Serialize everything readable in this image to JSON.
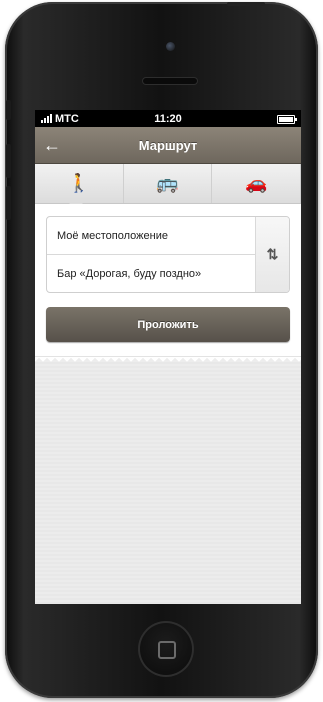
{
  "statusbar": {
    "carrier": "МТС",
    "time": "11:20"
  },
  "navbar": {
    "title": "Маршрут",
    "back_icon": "arrow-left-icon"
  },
  "tabs": [
    {
      "icon": "walking-icon",
      "glyph": "🚶",
      "active": true
    },
    {
      "icon": "bus-icon",
      "glyph": "🚌",
      "active": false
    },
    {
      "icon": "car-icon",
      "glyph": "🚗",
      "active": false
    }
  ],
  "route": {
    "from": "Моё местоположение",
    "to": "Бар «Дорогая, буду поздно»",
    "swap_glyph": "⇅"
  },
  "build_button": {
    "label": "Проложить"
  },
  "colors": {
    "navbar": "#7d766b",
    "button": "#67615a",
    "content_bg": "#ececec"
  }
}
